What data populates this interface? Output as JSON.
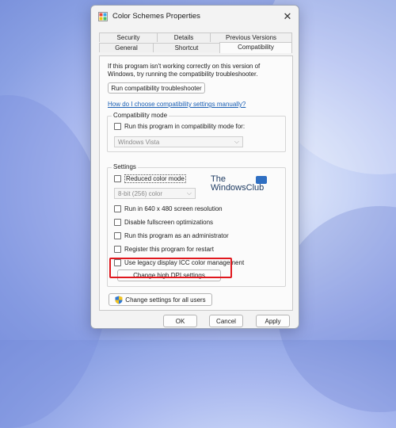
{
  "window": {
    "title": "Color Schemes Properties",
    "close_glyph": "✕"
  },
  "tabs": {
    "row1": [
      "Security",
      "Details",
      "Previous Versions"
    ],
    "row2": [
      "General",
      "Shortcut",
      "Compatibility"
    ],
    "active": "Compatibility"
  },
  "compat": {
    "intro": "If this program isn't working correctly on this version of Windows, try running the compatibility troubleshooter.",
    "troubleshooter_button": "Run compatibility troubleshooter",
    "manual_link": "How do I choose compatibility settings manually?",
    "mode_group_label": "Compatibility mode",
    "mode_checkbox": "Run this program in compatibility mode for:",
    "mode_select_value": "Windows Vista"
  },
  "settings": {
    "group_label": "Settings",
    "reduced_color_mode": "Reduced color mode",
    "color_select_value": "8-bit (256) color",
    "run_640": "Run in 640 x 480 screen resolution",
    "disable_fullscreen": "Disable fullscreen optimizations",
    "run_admin": "Run this program as an administrator",
    "register_restart": "Register this program for restart",
    "legacy_icc": "Use legacy display ICC color management",
    "dpi_button": "Change high DPI settings"
  },
  "all_users_button": "Change settings for all users",
  "watermark": {
    "line1": "The",
    "line2": "WindowsClub"
  },
  "footer": {
    "ok": "OK",
    "cancel": "Cancel",
    "apply": "Apply"
  },
  "colors": {
    "highlight": "#e0181e",
    "link": "#1a5fb4"
  }
}
